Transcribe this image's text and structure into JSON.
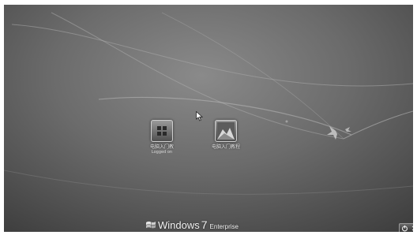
{
  "users": [
    {
      "name": "电脑入门教",
      "status": "Logged on",
      "icon": "windows-logo-icon"
    },
    {
      "name": "电脑入门教程",
      "status": "",
      "icon": "user-photo-icon"
    }
  ],
  "branding": {
    "windows": "Windows",
    "version": "7",
    "edition": "Enterprise"
  },
  "shutdown": {
    "icon": "power-icon",
    "menu_icon": "chevron-right-icon"
  },
  "colors": {
    "background": "#6b6b6b",
    "text": "#ececec"
  }
}
